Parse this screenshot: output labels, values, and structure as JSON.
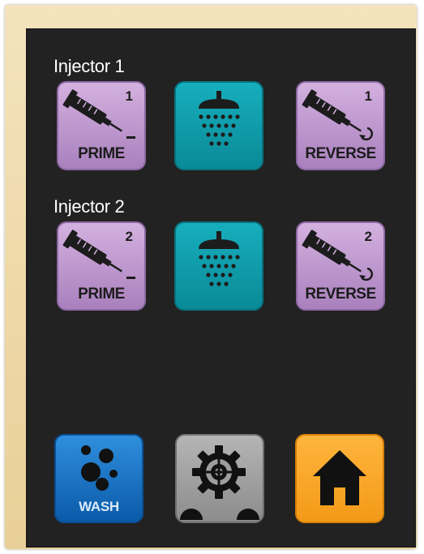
{
  "injectors": [
    {
      "label": "Injector 1",
      "prime": {
        "number": "1",
        "label": "PRIME",
        "icon": "syringe-icon",
        "color": "#c9a4d8"
      },
      "wash": {
        "icon": "shower-icon",
        "color": "#139fae"
      },
      "reverse": {
        "number": "1",
        "label": "REVERSE",
        "icon": "syringe-icon",
        "color": "#c9a4d8"
      }
    },
    {
      "label": "Injector 2",
      "prime": {
        "number": "2",
        "label": "PRIME",
        "icon": "syringe-icon",
        "color": "#c9a4d8"
      },
      "wash": {
        "icon": "shower-icon",
        "color": "#139fae"
      },
      "reverse": {
        "number": "2",
        "label": "REVERSE",
        "icon": "syringe-icon",
        "color": "#c9a4d8"
      }
    }
  ],
  "bottom_bar": {
    "wash": {
      "label": "WASH",
      "icon": "bubbles-icon",
      "color": "#1a74c6"
    },
    "settings": {
      "icon": "gear-icon",
      "color": "#a3a3a3"
    },
    "home": {
      "icon": "home-icon",
      "color": "#f7a52a"
    }
  },
  "colors": {
    "screen": "#222222",
    "bezel": "#ecd6a6"
  }
}
